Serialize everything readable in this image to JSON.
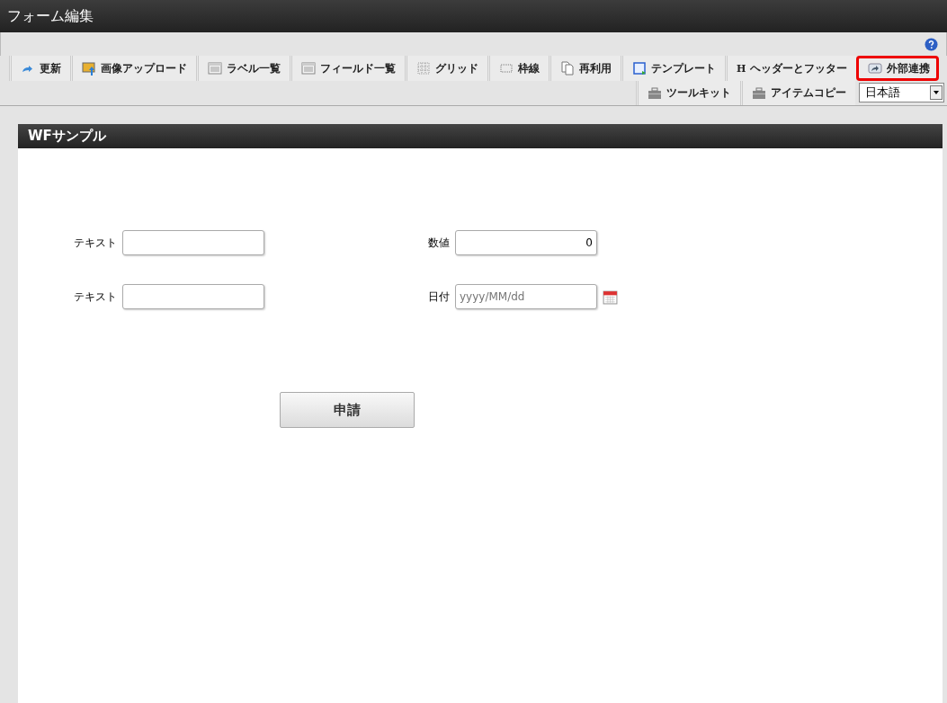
{
  "window": {
    "title": "フォーム編集"
  },
  "toolbar": {
    "row_1": [
      {
        "label": "更新",
        "kind": "refresh",
        "highlighted": false
      },
      {
        "label": "画像アップロード",
        "kind": "image",
        "highlighted": false
      },
      {
        "label": "ラベル一覧",
        "kind": "list",
        "highlighted": false
      },
      {
        "label": "フィールド一覧",
        "kind": "list",
        "highlighted": false
      },
      {
        "label": "グリッド",
        "kind": "grid",
        "highlighted": false
      },
      {
        "label": "枠線",
        "kind": "border",
        "highlighted": false
      },
      {
        "label": "再利用",
        "kind": "copy",
        "highlighted": false
      },
      {
        "label": "テンプレート",
        "kind": "template",
        "highlighted": false
      },
      {
        "label": "ヘッダーとフッター",
        "kind": "letter",
        "icon_text": "H",
        "highlighted": false
      },
      {
        "label": "外部連携",
        "kind": "share",
        "highlighted": true
      }
    ],
    "row_2": [
      {
        "label": "ツールキット",
        "kind": "toolbox"
      },
      {
        "label": "アイテムコピー",
        "kind": "toolbox"
      }
    ],
    "language": {
      "value": "日本語"
    }
  },
  "form": {
    "title": "WFサンプル",
    "fields": [
      {
        "label": "テキスト",
        "kind": "text"
      },
      {
        "label": "数値",
        "kind": "number",
        "value": "0"
      },
      {
        "label": "テキスト",
        "kind": "text"
      },
      {
        "label": "日付",
        "kind": "date",
        "placeholder": "yyyy/MM/dd"
      }
    ],
    "submit": "申請"
  }
}
